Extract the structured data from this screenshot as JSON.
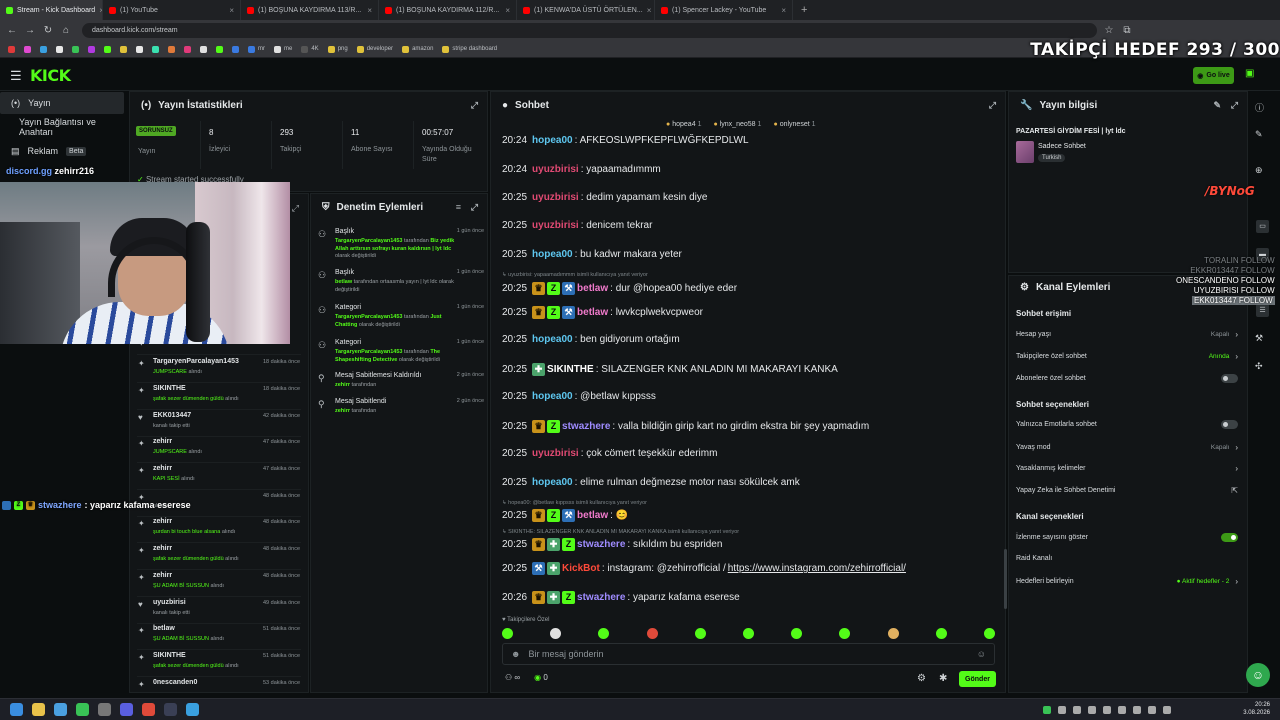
{
  "browser": {
    "tabs": [
      {
        "title": "Stream - Kick Dashboard",
        "active": true,
        "color": "#53fc18"
      },
      {
        "title": "(1) YouTube",
        "color": "#ff0000"
      },
      {
        "title": "(1) BOŞUNA KAYDIRMA 113/R...",
        "color": "#ff0000"
      },
      {
        "title": "(1) BOŞUNA KAYDIRMA 112/R...",
        "color": "#ff0000"
      },
      {
        "title": "(1) KENWA'DA ÜSTÜ ÖRTÜLEN...",
        "color": "#ff0000"
      },
      {
        "title": "(1) Spencer Lackey - YouTube",
        "color": "#ff0000"
      }
    ],
    "url": "dashboard.kick.com/stream",
    "bookmarks": [
      "",
      "",
      "",
      "",
      "",
      "",
      "",
      "",
      "",
      "",
      "",
      "",
      "",
      "",
      "",
      "mr",
      "me",
      "4K",
      "png",
      "developer",
      "amazon",
      "stripe dashboard"
    ]
  },
  "overlay": {
    "follow_goal": "TAKİPÇİ HEDEF 293 / 300",
    "cam_name": "zehirr216",
    "cam_name_prefix": "discord.gg",
    "chat_user": "stwazhere",
    "chat_text": ": yaparız kafama eserese",
    "logo_text": "/BYNoG",
    "follows": [
      "TORALIN FOLLOW",
      "EKKR013447 FOLLOW",
      "ONESCANDENO FOLLOW",
      "UYUZBIRISI FOLLOW",
      "EKK013447 FOLLOW"
    ]
  },
  "header": {
    "logo": "KICK",
    "go_live": "Go live"
  },
  "leftnav": {
    "items": [
      "Yayın",
      "Yayın Bağlantısı ve Anahtarı",
      "Reklam"
    ],
    "beta": "Beta"
  },
  "stats": {
    "title": "Yayın İstatistikleri",
    "status_badge": "SORUNSUZ",
    "status_label": "Yayın",
    "items": [
      {
        "value": "8",
        "label": "İzleyici"
      },
      {
        "value": "293",
        "label": "Takipçi"
      },
      {
        "value": "11",
        "label": "Abone Sayısı"
      },
      {
        "value": "00:57:07",
        "label": "Yayında Olduğu Süre"
      }
    ],
    "started": "Stream started successfully"
  },
  "activity": [
    {
      "icon": "star",
      "name": "",
      "detail": "şafak sezer dümenden güldü",
      "suffix": "alındı",
      "time": ""
    },
    {
      "icon": "star",
      "name": "TargaryenParcalayan1453",
      "detail": "JUMPSCARE",
      "suffix": "alındı",
      "time": "18 dakika önce"
    },
    {
      "icon": "star",
      "name": "SIKINTHE",
      "detail": "şafak sezer dümenden güldü",
      "suffix": "alındı",
      "time": "18 dakika önce"
    },
    {
      "icon": "heart",
      "name": "EKK013447",
      "detail": "",
      "suffix": "kanalı takip etti",
      "time": "42 dakika önce"
    },
    {
      "icon": "star",
      "name": "zehirr",
      "detail": "JUMPSCARE",
      "suffix": "alındı",
      "time": "47 dakika önce"
    },
    {
      "icon": "star",
      "name": "zehirr",
      "detail": "KAPI SESİ",
      "suffix": "alındı",
      "time": "47 dakika önce"
    },
    {
      "icon": "star",
      "name": "",
      "detail": "",
      "suffix": "alındı",
      "time": "48 dakika önce"
    },
    {
      "icon": "star",
      "name": "zehirr",
      "detail": "şurdan bi touch blue alsana",
      "suffix": "alındı",
      "time": "48 dakika önce"
    },
    {
      "icon": "star",
      "name": "zehirr",
      "detail": "şafak sezer dümenden güldü",
      "suffix": "alındı",
      "time": "48 dakika önce"
    },
    {
      "icon": "star",
      "name": "zehirr",
      "detail": "ŞU ADAM Bİ SUSSUN",
      "suffix": "alındı",
      "time": "48 dakika önce"
    },
    {
      "icon": "heart",
      "name": "uyuzbirisi",
      "detail": "",
      "suffix": "kanalı takip etti",
      "time": "49 dakika önce"
    },
    {
      "icon": "star",
      "name": "betlaw",
      "detail": "ŞU ADAM Bİ SUSSUN",
      "suffix": "alındı",
      "time": "51 dakika önce"
    },
    {
      "icon": "star",
      "name": "SIKINTHE",
      "detail": "şafak sezer dümenden güldü",
      "suffix": "alındı",
      "time": "51 dakika önce"
    },
    {
      "icon": "star",
      "name": "0nescanden0",
      "detail": "",
      "suffix": "",
      "time": "53 dakika önce"
    }
  ],
  "moderation": {
    "title": "Denetim Eylemleri",
    "items": [
      {
        "icon": "person",
        "head": "Başlık",
        "time": "1 gün önce",
        "who": "TargaryenParcalayan1453",
        "text": " tarafından ",
        "bold2": "Biz yedik Allah arttırsın sofrayı kuran kaldırsın | lyt ldc",
        "tail": " olarak değiştirildi"
      },
      {
        "icon": "person",
        "head": "Başlık",
        "time": "1 gün önce",
        "who": "betlaw",
        "text": " tarafından ortaasmla yayın | lyt ldc olarak değiştirildi",
        "bold2": "",
        "tail": ""
      },
      {
        "icon": "person",
        "head": "Kategori",
        "time": "1 gün önce",
        "who": "TargaryenParcalayan1453",
        "text": " tarafından ",
        "bold2": "Just Chatting",
        "tail": " olarak değiştirildi"
      },
      {
        "icon": "person",
        "head": "Kategori",
        "time": "1 gün önce",
        "who": "TargaryenParcalayan1453",
        "text": " tarafından ",
        "bold2": "The Shapeshifting Detective",
        "tail": " olarak değiştirildi"
      },
      {
        "icon": "pin",
        "head": "Mesaj Sabitlemesi Kaldırıldı",
        "time": "2 gün önce",
        "who": "zehirr",
        "text": " tarafından",
        "bold2": "",
        "tail": ""
      },
      {
        "icon": "pin",
        "head": "Mesaj Sabitlendi",
        "time": "2 gün önce",
        "who": "zehirr",
        "text": " tarafından",
        "bold2": "",
        "tail": ""
      }
    ]
  },
  "chat": {
    "title": "Sohbet",
    "pinned": [
      {
        "name": "hopea4",
        "count": "1"
      },
      {
        "name": "lynx_neo58",
        "count": "1"
      },
      {
        "name": "onlyneset",
        "count": "1"
      }
    ],
    "messages": [
      {
        "time": "20:24",
        "user": "hopea00",
        "color": "#5ec7f0",
        "badges": [],
        "text": ": AFKEOSLWPFKEPFLWĞFKEPDLWL"
      },
      {
        "time": "20:24",
        "user": "uyuzbirisi",
        "color": "#e04a73",
        "badges": [],
        "text": ": yapaamadımmm"
      },
      {
        "time": "20:25",
        "user": "uyuzbirisi",
        "color": "#e04a73",
        "badges": [],
        "text": ": dedim yapamam kesin diye"
      },
      {
        "time": "20:25",
        "user": "uyuzbirisi",
        "color": "#e04a73",
        "badges": [],
        "text": ": denicem tekrar"
      },
      {
        "time": "20:25",
        "user": "hopea00",
        "color": "#5ec7f0",
        "badges": [],
        "text": ": bu kadwr makara yeter"
      },
      {
        "time": "20:25",
        "user": "betlaw",
        "color": "#f07acb",
        "badges": [
          "crown",
          "z",
          "blue"
        ],
        "text": ": dur @hopea00 hediye eder"
      },
      {
        "time": "20:25",
        "user": "betlaw",
        "color": "#f07acb",
        "badges": [
          "crown",
          "z",
          "blue"
        ],
        "text": ": lwvkcplwekvcpweor"
      },
      {
        "time": "20:25",
        "user": "hopea00",
        "color": "#5ec7f0",
        "badges": [],
        "text": ": ben gidiyorum ortağım"
      },
      {
        "time": "20:25",
        "user": "SIKINTHE",
        "color": "#ffffff",
        "badges": [
          "g"
        ],
        "text": ": SILAZENGER KNK ANLADIN MI MAKARAYI KANKA"
      },
      {
        "time": "20:25",
        "user": "hopea00",
        "color": "#5ec7f0",
        "badges": [],
        "text": ": @betlaw kıppsss"
      },
      {
        "time": "20:25",
        "user": "stwazhere",
        "color": "#9f8cff",
        "badges": [
          "crown",
          "z"
        ],
        "text": ": valla bildiğin girip kart no girdim ekstra bir şey yapmadım"
      },
      {
        "time": "20:25",
        "user": "uyuzbirisi",
        "color": "#e04a73",
        "badges": [],
        "text": ": çok cömert teşekkür ederimm"
      },
      {
        "time": "20:25",
        "user": "hopea00",
        "color": "#5ec7f0",
        "badges": [],
        "text": ": elime rulman değmezse motor nası sökülcek amk"
      },
      {
        "time": "20:25",
        "user": "betlaw",
        "color": "#f07acb",
        "badges": [
          "crown",
          "z",
          "blue"
        ],
        "text": ": 😊"
      },
      {
        "time": "20:25",
        "user": "stwazhere",
        "color": "#9f8cff",
        "badges": [
          "crown",
          "g",
          "z"
        ],
        "text": ": sıkıldım bu espriden"
      },
      {
        "time": "20:25",
        "user": "KickBot",
        "color": "#ff4a3a",
        "badges": [
          "blue",
          "g"
        ],
        "text": ": instagram: @zehirrofficial / ",
        "link": "https://www.instagram.com/zehirrofficial/"
      },
      {
        "time": "20:26",
        "user": "stwazhere",
        "color": "#9f8cff",
        "badges": [
          "crown",
          "g",
          "z"
        ],
        "text": ": yaparız kafama eserese"
      }
    ],
    "system": [
      "uyuzbirisi: yapaamadımmm isimli kullanıcıya yanıt veriyor",
      "hopea00: @betlaw kıppsss isimli kullanıcıya yanıt veriyor",
      "SIKINTHE: SILAZENGER KNK ANLADIN MI MAKARAYI KANKA isimli kullanıcıya yanıt veriyor"
    ],
    "followers_only": "Takipçilere Özel",
    "input_placeholder": "Bir mesaj gönderin",
    "send": "Gönder",
    "viewers_icon": "∞",
    "points": "0"
  },
  "info": {
    "title": "Yayın bilgisi",
    "stream_title": "PAZARTESİ GİYDİM FESİ | lyt ldc",
    "category": "Sadece Sohbet",
    "language": "Turkish"
  },
  "channel": {
    "title": "Kanal Eylemleri",
    "sections": {
      "access": "Sohbet erişimi",
      "options": "Sohbet seçenekleri",
      "channel": "Kanal seçenekleri"
    },
    "rows": [
      {
        "label": "Hesap yaşı",
        "value": "Kapalı",
        "kind": "chevron"
      },
      {
        "label": "Takipçilere özel sohbet",
        "value": "Anında",
        "kind": "chevron-on"
      },
      {
        "label": "Abonelere özel sohbet",
        "value": "",
        "kind": "toggle-off"
      },
      {
        "label": "Yalnızca Emotlarla sohbet",
        "value": "",
        "kind": "toggle-off"
      },
      {
        "label": "Yavaş mod",
        "value": "Kapalı",
        "kind": "chevron"
      },
      {
        "label": "Yasaklanmış kelimeler",
        "value": "",
        "kind": "chevron"
      },
      {
        "label": "Yapay Zeka ile Sohbet Denetimi",
        "value": "",
        "kind": "external"
      },
      {
        "label": "İzlenme sayısını göster",
        "value": "",
        "kind": "toggle-on"
      },
      {
        "label": "Raid Kanalı",
        "value": "",
        "kind": "none"
      },
      {
        "label": "Hedefleri belirleyin",
        "value": "● Aktif hedefler - 2",
        "kind": "chevron-on"
      }
    ]
  },
  "taskbar": {
    "time": "20:26",
    "date": "3.08.2026"
  }
}
